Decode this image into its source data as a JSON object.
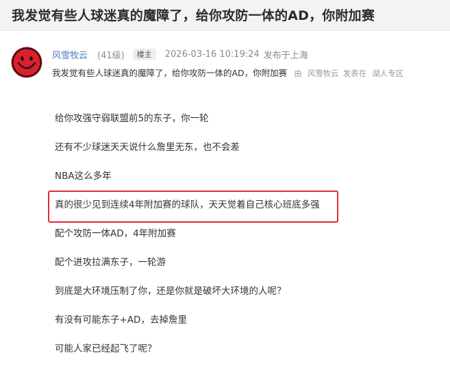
{
  "post": {
    "title": "我发觉有些人球迷真的魔障了，给你攻防一体的AD，你附加赛"
  },
  "author": {
    "username": "风雪牧云",
    "level": "(41级)",
    "badge": "楼主",
    "timestamp": "2026-03-16 10:19:24",
    "location": "发布于上海"
  },
  "summary": {
    "text": "我发觉有些人球迷真的魔障了，给你攻防一体的AD，你附加赛",
    "by_prefix": "由",
    "by_author": "风雪牧云",
    "published_in": "发表在",
    "forum": "湖人专区"
  },
  "body_lines": [
    "给你攻强守弱联盟前5的东子，你一轮",
    "还有不少球迷天天说什么詹里无东，也不会差",
    "NBA这么多年",
    "真的很少见到连续4年附加赛的球队，天天觉着自己核心班底多强",
    "配个攻防一体AD，4年附加赛",
    "配个进攻拉满东子，一轮游",
    "到底是大环境压制了你，还是你就是破坏大环境的人呢？",
    "有没有可能东子+AD，去掉詹里",
    "可能人家已经起飞了呢？"
  ],
  "colors": {
    "highlight_border": "#e0293a",
    "username": "#4b7cc9",
    "avatar_fill": "#e01e2a"
  },
  "icons": {
    "avatar": "smiley-face-icon"
  }
}
